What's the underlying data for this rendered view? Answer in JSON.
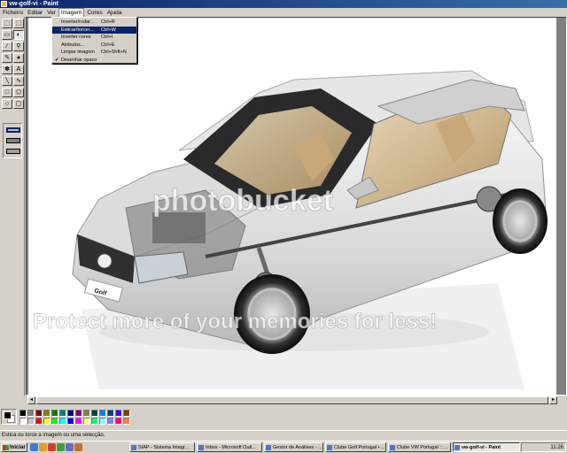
{
  "window": {
    "title": "vw-golf-vi - Paint"
  },
  "menubar": [
    "Ficheiro",
    "Editar",
    "Ver",
    "Imagem",
    "Cores",
    "Ajuda"
  ],
  "image_menu": {
    "items": [
      {
        "label": "Inverter/rodar...",
        "shortcut": "Ctrl+R",
        "highlighted": false,
        "checked": false
      },
      {
        "label": "Esticar/torcer...",
        "shortcut": "Ctrl+W",
        "highlighted": true,
        "checked": false
      },
      {
        "label": "Inverter cores",
        "shortcut": "Ctrl+I",
        "highlighted": false,
        "checked": false
      },
      {
        "label": "Atributos...",
        "shortcut": "Ctrl+E",
        "highlighted": false,
        "checked": false
      },
      {
        "label": "Limpar imagem",
        "shortcut": "Ctrl+Shft+N",
        "highlighted": false,
        "checked": false
      },
      {
        "label": "Desenhar opaco",
        "shortcut": "",
        "highlighted": false,
        "checked": true
      }
    ]
  },
  "toolbox": {
    "tools": [
      "free-select",
      "rect-select",
      "eraser",
      "fill",
      "color-picker",
      "magnifier",
      "pencil",
      "brush",
      "airbrush",
      "text",
      "line",
      "curve",
      "rectangle",
      "polygon",
      "ellipse",
      "rounded-rect"
    ],
    "glyphs": [
      "⬚",
      "⬚",
      "▭",
      "◐",
      "⁄",
      "⚲",
      "✎",
      "♠",
      "✽",
      "A",
      "╲",
      "∿",
      "□",
      "⬠",
      "○",
      "▢"
    ]
  },
  "canvas": {
    "watermark_top": "photobucket",
    "watermark_bottom": "Protect more of your memories for less!",
    "badge_text": "Golf"
  },
  "palette": {
    "foreground": "#000000",
    "background": "#ffffff",
    "colors": [
      "#000000",
      "#808080",
      "#800000",
      "#808000",
      "#008000",
      "#008080",
      "#000080",
      "#800080",
      "#808040",
      "#004040",
      "#0080ff",
      "#004080",
      "#4000ff",
      "#804000",
      "#ffffff",
      "#c0c0c0",
      "#ff0000",
      "#ffff00",
      "#00ff00",
      "#00ffff",
      "#0000ff",
      "#ff00ff",
      "#ffff80",
      "#00ff80",
      "#80ffff",
      "#8080ff",
      "#ff0080",
      "#ff8040"
    ]
  },
  "statusbar": {
    "text": "Estica ou torce a imagem ou uma selecção."
  },
  "taskbar": {
    "start_label": "Iniciar",
    "quicklaunch_colors": [
      "#3a7bd5",
      "#e0a020",
      "#d04030",
      "#40a040",
      "#6a6ac0",
      "#c07030"
    ],
    "tasks": [
      {
        "label": "SIAP - Sistema Integr...",
        "active": false
      },
      {
        "label": "Inbox - Microsoft Outl...",
        "active": false
      },
      {
        "label": "Gestor de Análises - ...",
        "active": false
      },
      {
        "label": "Clube Golf Portugal • ...",
        "active": false
      },
      {
        "label": "Clube VW Portugal :: ...",
        "active": false
      },
      {
        "label": "vw-golf-vi - Paint",
        "active": true
      }
    ],
    "clock": "11:26"
  }
}
